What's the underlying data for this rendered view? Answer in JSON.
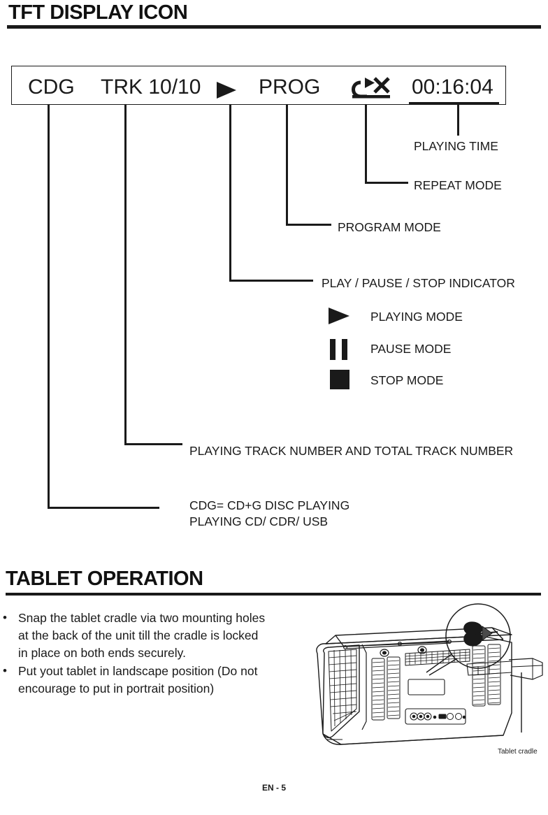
{
  "page": {
    "footer": "EN - 5"
  },
  "sections": {
    "tft": {
      "title": "TFT DISPLAY ICON"
    },
    "tablet": {
      "title": "TABLET OPERATION"
    }
  },
  "display": {
    "source": "CDG",
    "track": "TRK 10/10",
    "play_icon": "play-triangle-icon",
    "program": "PROG",
    "repeat_icon": "repeat-off-icon",
    "time": "00:16:04"
  },
  "annotations": [
    {
      "id": "playing-time",
      "label": "PLAYING TIME"
    },
    {
      "id": "repeat-mode",
      "label": "REPEAT MODE"
    },
    {
      "id": "program-mode",
      "label": "PROGRAM MODE"
    },
    {
      "id": "play-pause-stop",
      "label": "PLAY / PAUSE / STOP  INDICATOR"
    },
    {
      "id": "track-number",
      "label": "PLAYING TRACK NUMBER AND TOTAL TRACK NUMBER"
    },
    {
      "id": "cdg-line-1",
      "label": "CDG= CD+G DISC PLAYING"
    },
    {
      "id": "cdg-line-2",
      "label": "PLAYING CD/ CDR/ USB"
    }
  ],
  "mode_legend": [
    {
      "icon": "play-triangle-icon",
      "label": "PLAYING MODE"
    },
    {
      "icon": "pause-bars-icon",
      "label": "PAUSE MODE"
    },
    {
      "icon": "stop-square-icon",
      "label": "STOP MODE"
    }
  ],
  "tablet_instructions": {
    "bullet_char": "•",
    "items": [
      "Snap the tablet cradle via two mounting holes\nat the back of the unit till the cradle is locked\nin place on both ends securely.",
      "Put yout tablet in landscape position (Do not\nencourage to put in portrait position)"
    ]
  },
  "illustration": {
    "cradle_label": "Tablet cradle",
    "line_color": "#1a1a1a"
  }
}
